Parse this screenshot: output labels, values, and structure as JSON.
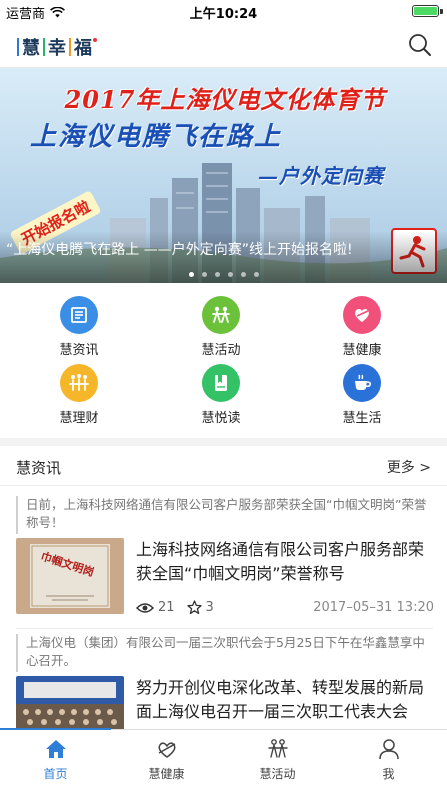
{
  "status_bar": {
    "carrier": "运营商",
    "time": "上午10:24",
    "battery_level": 1.0
  },
  "header": {
    "logo_text": [
      "慧",
      "幸",
      "福"
    ],
    "search_icon": "search-icon"
  },
  "banner": {
    "headline_1": "2017年上海仪电文化体育节",
    "headline_2": "上海仪电腾飞在路上",
    "headline_3": "—户外定向赛",
    "sign_text": "开始报名啦",
    "caption": "“上海仪电腾飞在路上 ——户外定向赛”线上开始报名啦!",
    "page_count": 6,
    "active_page": 0
  },
  "quick_menu": [
    {
      "label": "慧资讯",
      "icon": "news-icon",
      "color": "#3a8ee6"
    },
    {
      "label": "慧活动",
      "icon": "activity-icon",
      "color": "#6cc13a"
    },
    {
      "label": "慧健康",
      "icon": "health-icon",
      "color": "#f0507a"
    },
    {
      "label": "慧理财",
      "icon": "finance-icon",
      "color": "#f5b62a"
    },
    {
      "label": "慧悦读",
      "icon": "reading-icon",
      "color": "#34c266"
    },
    {
      "label": "慧生活",
      "icon": "life-icon",
      "color": "#2b72d8"
    }
  ],
  "news_section": {
    "title": "慧资讯",
    "more_label": "更多 >"
  },
  "news": [
    {
      "summary": "日前，上海科技网络通信有限公司客户服务部荣获全国“巾帼文明岗”荣誉称号！",
      "title": "上海科技网络通信有限公司客户服务部荣获全国“巾帼文明岗”荣誉称号",
      "views": "21",
      "stars": "3",
      "date": "2017–05–31 13:20",
      "thumb_text": "巾帼文明岗"
    },
    {
      "summary": "上海仪电（集团）有限公司一届三次职代会于5月25日下午在华鑫慧享中心召开。",
      "title": "努力开创仪电深化改革、转型发展的新局面上海仪电召开一届三次职工代表大会"
    }
  ],
  "tabbar": {
    "active_index": 0,
    "items": [
      {
        "label": "首页",
        "icon": "home-icon"
      },
      {
        "label": "慧健康",
        "icon": "health-leaf-icon"
      },
      {
        "label": "慧活动",
        "icon": "people-icon"
      },
      {
        "label": "我",
        "icon": "user-icon"
      }
    ]
  },
  "colors": {
    "accent": "#2f7fd6",
    "banner_red": "#e0211a",
    "banner_blue": "#1a4fb5"
  }
}
